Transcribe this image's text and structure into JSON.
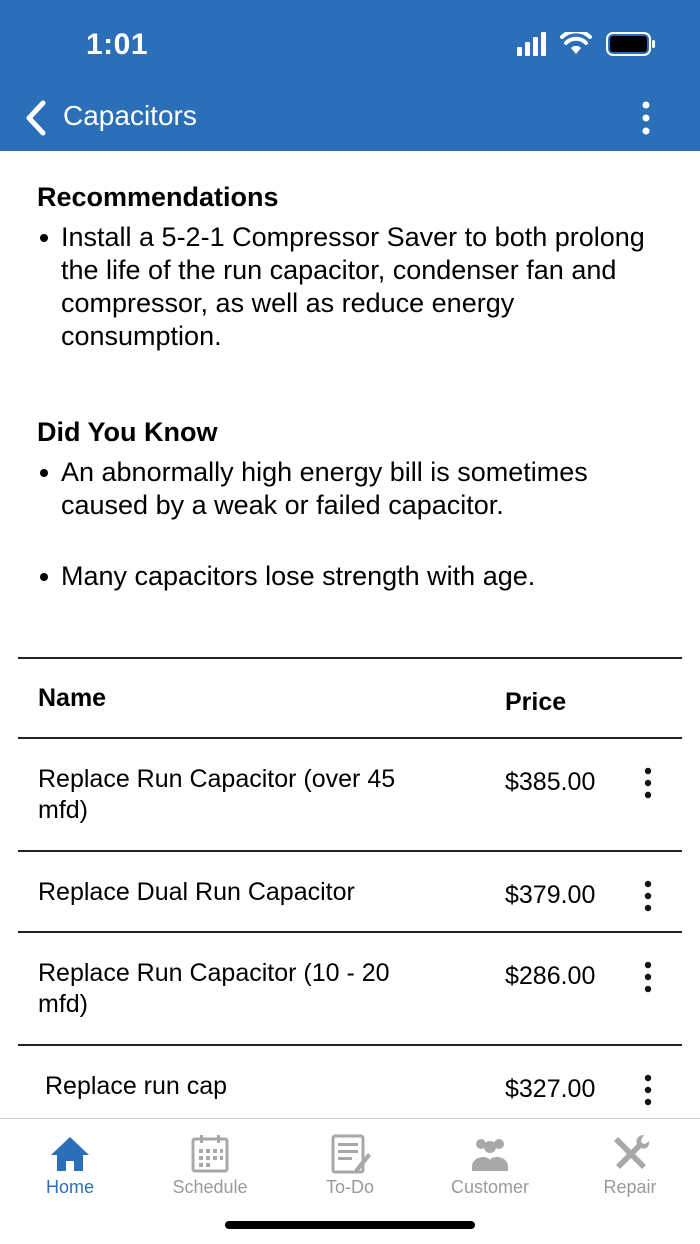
{
  "status_bar": {
    "time": "1:01"
  },
  "nav": {
    "title": "Capacitors"
  },
  "recommendations": {
    "title": "Recommendations",
    "items": [
      "Install a 5-2-1 Compressor Saver to both prolong the life of the run capacitor, condenser fan and compressor, as well as reduce energy consumption."
    ]
  },
  "did_you_know": {
    "title": "Did You Know",
    "items": [
      "An abnormally high energy bill is sometimes caused by a weak or failed capacitor.",
      "Many capacitors lose strength with age."
    ]
  },
  "table": {
    "headers": {
      "name": "Name",
      "price": "Price"
    },
    "rows": [
      {
        "name": "Replace Run Capacitor (over 45 mfd)",
        "price": "$385.00"
      },
      {
        "name": "Replace Dual Run Capacitor",
        "price": "$379.00"
      },
      {
        "name": "Replace Run Capacitor (10 - 20 mfd)",
        "price": "$286.00"
      },
      {
        "name": "Replace run cap",
        "price": "$327.00"
      }
    ]
  },
  "tabbar": {
    "tabs": [
      {
        "label": "Home",
        "icon": "home-icon",
        "active": true
      },
      {
        "label": "Schedule",
        "icon": "calendar-icon",
        "active": false
      },
      {
        "label": "To-Do",
        "icon": "todo-list-icon",
        "active": false
      },
      {
        "label": "Customer",
        "icon": "people-icon",
        "active": false
      },
      {
        "label": "Repair",
        "icon": "tools-icon",
        "active": false
      }
    ]
  },
  "colors": {
    "accent": "#2a6fb7",
    "inactive": "#9a9a9a"
  }
}
